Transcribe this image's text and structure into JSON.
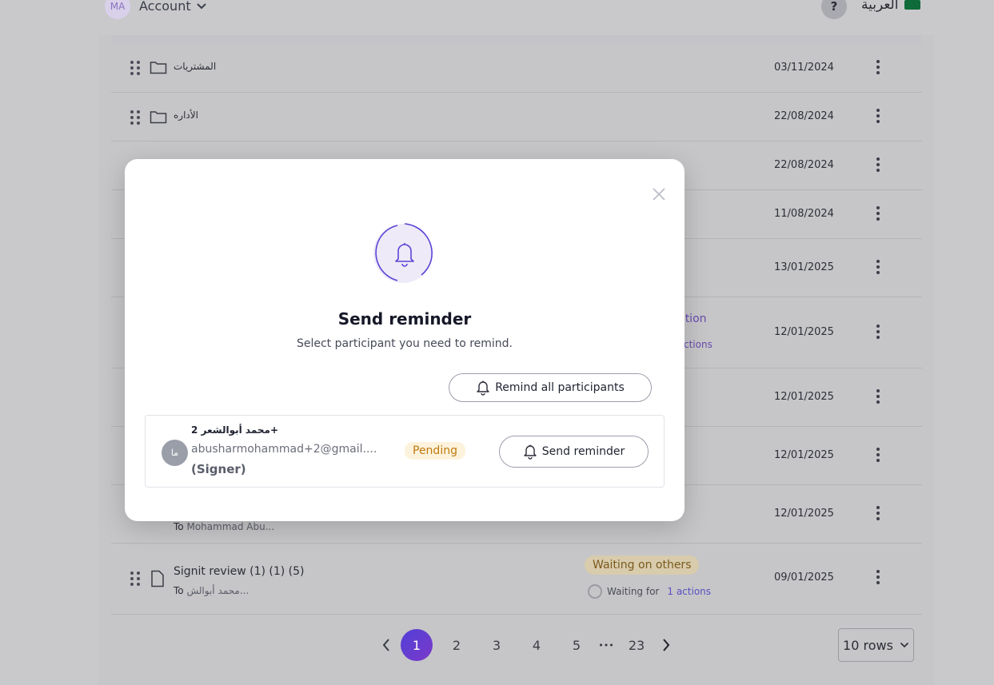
{
  "topbar": {
    "avatar_initials": "MA",
    "account_label": "Account",
    "help_label": "?",
    "language_label": "العربية"
  },
  "table": {
    "rows": [
      {
        "name": "المشتريات",
        "date": "03/11/2024"
      },
      {
        "name": "الأداره",
        "date": "22/08/2024"
      },
      {
        "date": "22/08/2024"
      },
      {
        "date": "11/08/2024"
      },
      {
        "date": "13/01/2025"
      },
      {
        "date": "12/01/2025",
        "partial_status": "ction",
        "partial_link": "ctions"
      },
      {
        "date": "12/01/2025"
      },
      {
        "date": "12/01/2025"
      },
      {
        "date": "12/01/2025",
        "to_prefix": "To",
        "to_value": "Mohammad Abu..."
      },
      {
        "name": "Signit review (1) (1) (5)",
        "date": "09/01/2025",
        "to_prefix": "To",
        "to_value": "محمد أبوالش...",
        "status": "Waiting on others",
        "waiting_label": "Waiting for",
        "waiting_link": "1 actions"
      }
    ]
  },
  "pagination": {
    "pages": [
      "1",
      "2",
      "3",
      "4",
      "5",
      "23"
    ],
    "current": "1",
    "ellipsis": "•••",
    "rows_select": "10 rows"
  },
  "modal": {
    "title": "Send reminder",
    "subtitle": "Select participant you need to remind.",
    "remind_all_label": "Remind all participants",
    "participant": {
      "avatar_initials": "ما",
      "name": "محمد أبوالشعر 2+",
      "email": "abusharmohammad+2@gmail....",
      "role": "(Signer)",
      "status": "Pending",
      "send_label": "Send reminder"
    }
  },
  "colors": {
    "accent": "#5b45d6",
    "pending_bg": "#fdf3dc",
    "pending_text": "#c07a10"
  }
}
